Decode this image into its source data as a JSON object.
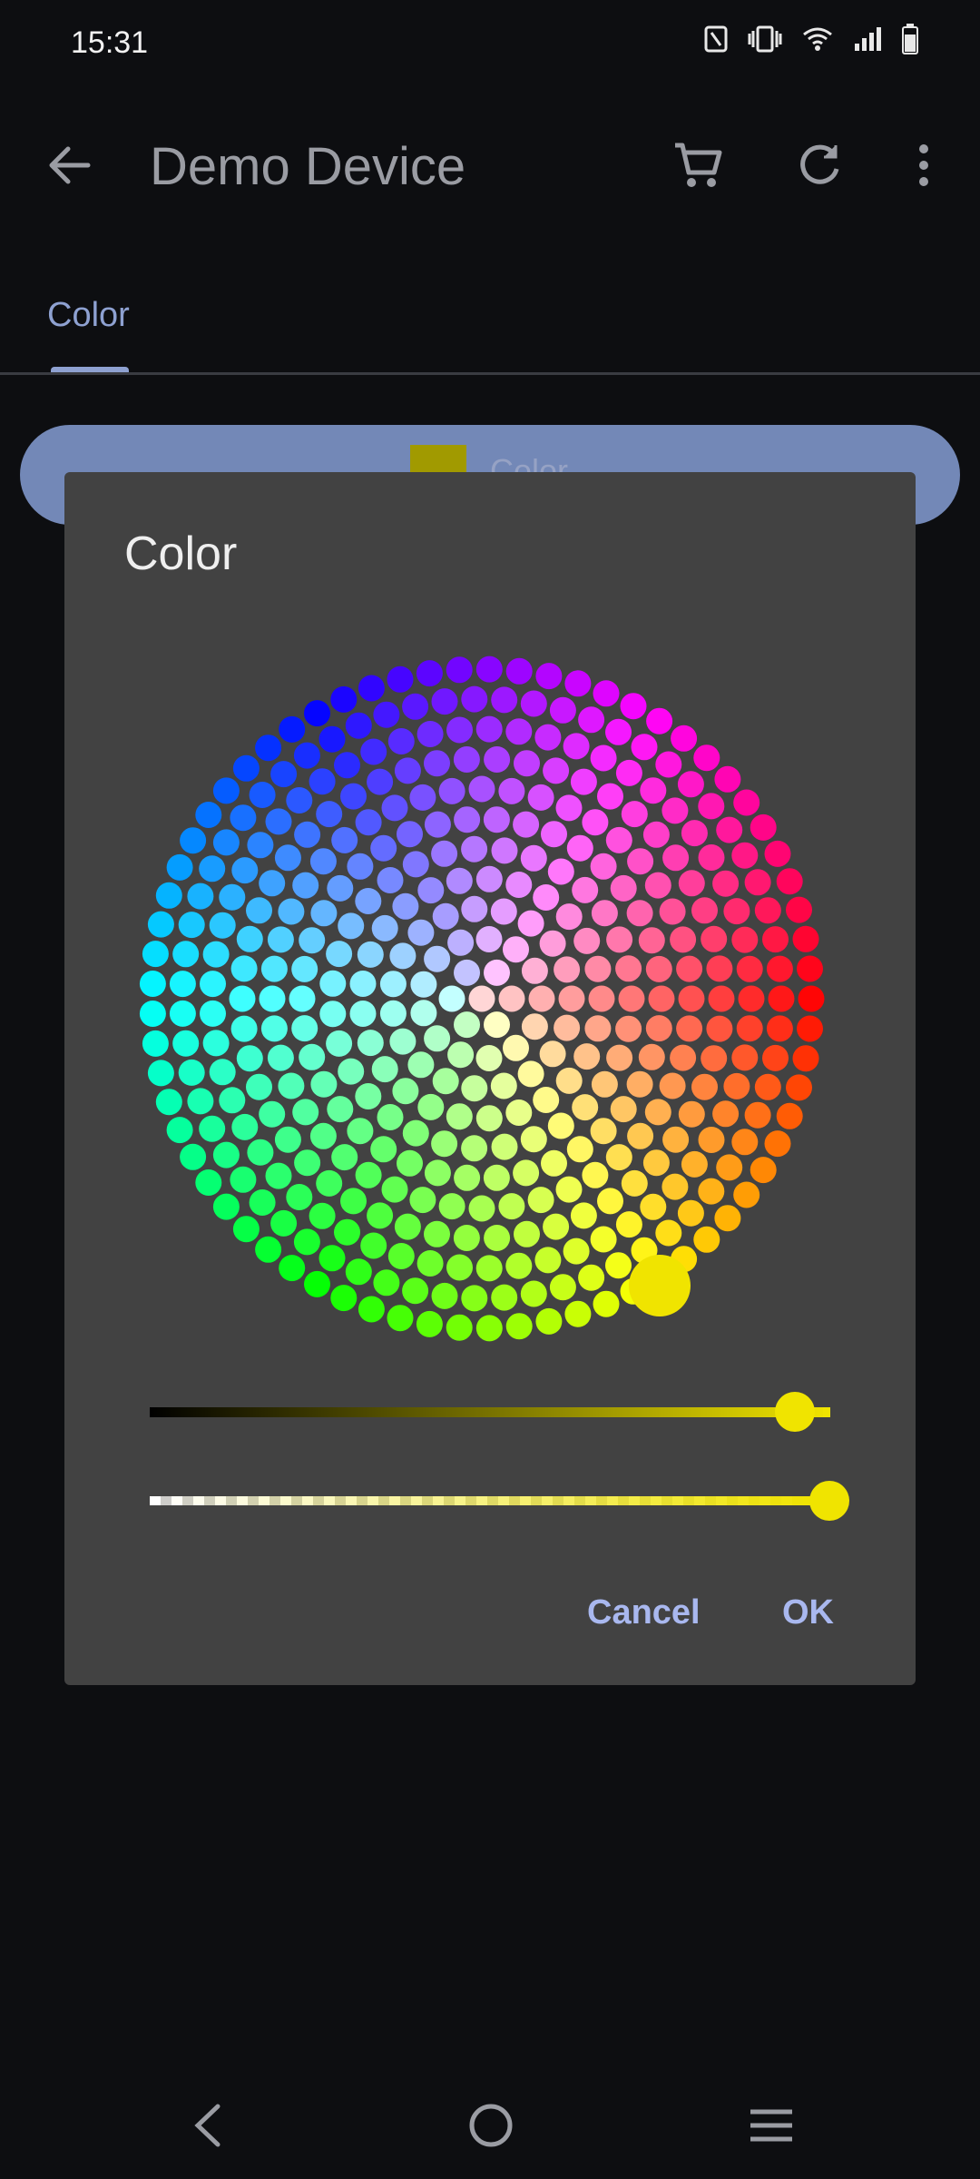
{
  "status_bar": {
    "time": "15:31",
    "icons": [
      "nfc-icon",
      "vibrate-icon",
      "wifi-icon",
      "signal-icon",
      "battery-icon"
    ]
  },
  "app_bar": {
    "title": "Demo Device",
    "actions": [
      "cart-icon",
      "refresh-icon",
      "more-vert-icon"
    ]
  },
  "tabs": [
    {
      "label": "Color",
      "selected": true
    }
  ],
  "background_control": {
    "label": "Color",
    "swatch_color": "#a19a00"
  },
  "dialog": {
    "title": "Color",
    "selected_color": "#f0e400",
    "brightness": 0.91,
    "alpha": 1.0,
    "cancel_label": "Cancel",
    "ok_label": "OK"
  },
  "colors": {
    "background": "#0d0e11",
    "dialog": "#424242",
    "accent": "#8ea1d1",
    "button_text": "#a9b8ef"
  },
  "nav_bar": {
    "buttons": [
      "back-nav-icon",
      "home-nav-icon",
      "recents-nav-icon"
    ]
  }
}
